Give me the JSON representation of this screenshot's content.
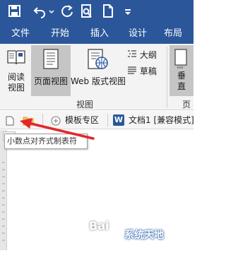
{
  "colors": {
    "ribbon_blue": "#2b579a",
    "arrow_red": "#e3262c",
    "word_blue": "#2b579a"
  },
  "qat": {
    "icons": [
      "save-icon",
      "undo-icon",
      "redo-icon",
      "print-preview-icon",
      "new-document-icon",
      "customize-dropdown-icon"
    ]
  },
  "tabs": [
    {
      "label": "文件"
    },
    {
      "label": "开始"
    },
    {
      "label": "插入"
    },
    {
      "label": "设计"
    },
    {
      "label": "布局"
    }
  ],
  "ribbon": {
    "read_mode": "阅读\n视图",
    "print_layout": "页面视图",
    "web_layout": "Web 版式视图",
    "outline": "大纲",
    "draft": "草稿",
    "group_views": "视图",
    "vertical": "垂\n直",
    "group_page_partial": "页面"
  },
  "docbar": {
    "template_zone": "模板专区",
    "doc_tab": "文档1 [兼容模式]"
  },
  "tooltip": {
    "text": "小数点对齐式制表符"
  },
  "watermark": {
    "brand": "Bai",
    "site": "系统天地"
  }
}
